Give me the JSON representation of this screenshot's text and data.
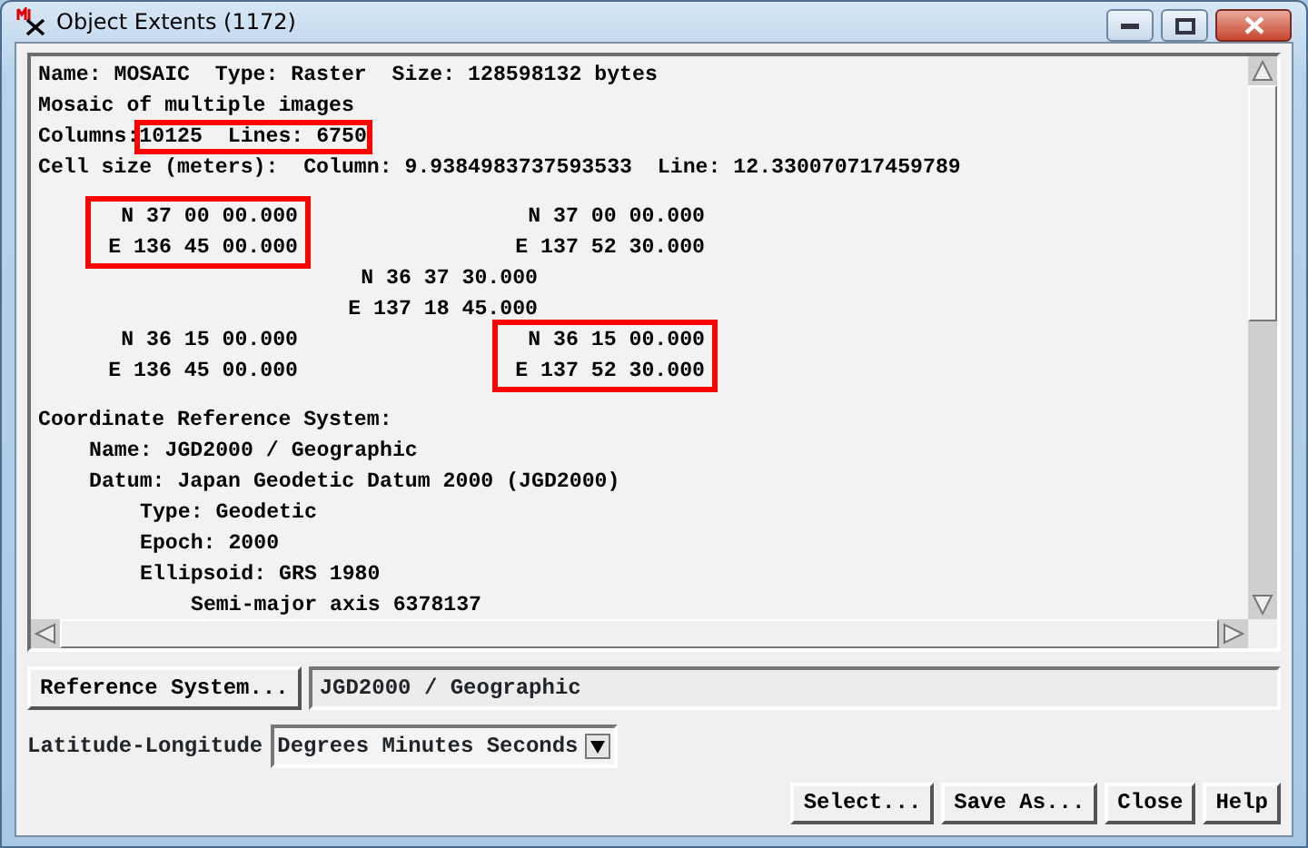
{
  "window": {
    "title": "Object Extents (1172)"
  },
  "info_lines": [
    {
      "text": "Name: MOSAIC  Type: Raster  Size: 128598132 bytes"
    },
    {
      "text": "Mosaic of multiple images"
    },
    {
      "text": "Columns:",
      "highlight": "10125  Lines: 6750"
    },
    {
      "text": "Cell size (meters):  Column: 9.9384983737593533  Line: 12.330070717459789"
    }
  ],
  "extent_rows": [
    [
      {
        "lat": "N 37 00 00.000",
        "lon": "E 136 45 00.000",
        "highlighted": true,
        "kind": "corner"
      },
      {
        "lat": "N 37 00 00.000",
        "lon": "E 137 52 30.000",
        "highlighted": false,
        "kind": "corner"
      }
    ],
    [
      {
        "lat": "N 36 37 30.000",
        "lon": "E 137 18 45.000",
        "highlighted": false,
        "kind": "center"
      }
    ],
    [
      {
        "lat": "N 36 15 00.000",
        "lon": "E 136 45 00.000",
        "highlighted": false,
        "kind": "corner"
      },
      {
        "lat": "N 36 15 00.000",
        "lon": "E 137 52 30.000",
        "highlighted": true,
        "kind": "corner"
      }
    ]
  ],
  "crs": {
    "text": "Coordinate Reference System:",
    "children": [
      {
        "text": "Name: JGD2000 / Geographic"
      },
      {
        "text": "Datum: Japan Geodetic Datum 2000 (JGD2000)",
        "children": [
          {
            "text": "Type: Geodetic"
          },
          {
            "text": "Epoch: 2000"
          },
          {
            "text": "Ellipsoid: GRS 1980",
            "children": [
              {
                "text": "Semi-major axis 6378137"
              }
            ]
          }
        ]
      }
    ]
  },
  "reference_system": {
    "button": "Reference System...",
    "value": "JGD2000 / Geographic"
  },
  "lat_long": {
    "label": "Latitude-Longitude",
    "value": "Degrees Minutes Seconds"
  },
  "buttons": [
    "Select...",
    "Save As...",
    "Close",
    "Help"
  ]
}
